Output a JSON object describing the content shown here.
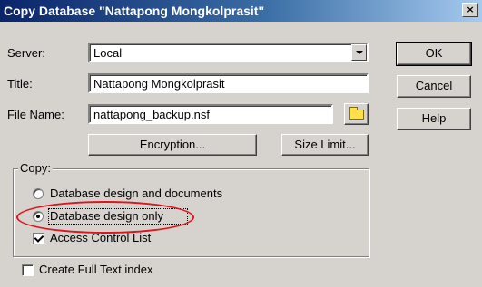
{
  "window": {
    "title": "Copy Database \"Nattapong Mongkolprasit\"",
    "close_glyph": "×"
  },
  "form": {
    "server_label": "Server:",
    "server_value": "Local",
    "title_label": "Title:",
    "title_value": "Nattapong Mongkolprasit",
    "filename_label": "File Name:",
    "filename_value": "nattapong_backup.nsf",
    "folder_icon": "folder-icon",
    "encryption_label": "Encryption...",
    "size_limit_label": "Size Limit..."
  },
  "buttons": {
    "ok": "OK",
    "cancel": "Cancel",
    "help": "Help"
  },
  "copy_group": {
    "label": "Copy:",
    "options": [
      {
        "label": "Database design and documents",
        "selected": false
      },
      {
        "label": "Database design only",
        "selected": true
      }
    ],
    "acl_label": "Access Control List",
    "acl_checked": true
  },
  "fulltext": {
    "label": "Create Full Text index",
    "checked": false
  },
  "annotation": {
    "color": "#e0141e"
  },
  "colors": {
    "dialog_bg": "#d6d3ce",
    "title_bar": "#0a246a"
  }
}
